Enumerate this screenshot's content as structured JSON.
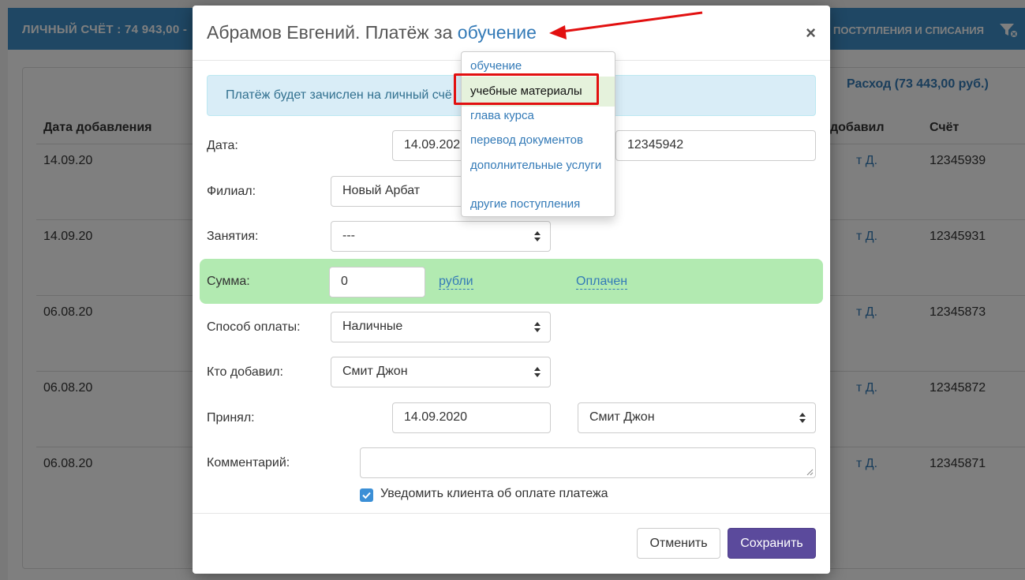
{
  "background": {
    "account_label": "ЛИЧНЫЙ СЧЁТ :  74 943,00 -",
    "flow_label": "ПОСТУПЛЕНИЯ И СПИСАНИЯ",
    "expense": "Расход (73 443,00 руб.)",
    "headers": {
      "date": "Дата добавления",
      "who": "добавил",
      "account": "Счёт"
    },
    "rows": [
      {
        "date": "14.09.20",
        "who": "т Д.",
        "account": "12345939"
      },
      {
        "date": "14.09.20",
        "who": "т Д.",
        "account": "12345931"
      },
      {
        "date": "06.08.20",
        "who": "т Д.",
        "account": "12345873"
      },
      {
        "date": "06.08.20",
        "who": "т Д.",
        "account": "12345872"
      },
      {
        "date": "06.08.20",
        "who": "т Д.",
        "account": "12345871"
      }
    ]
  },
  "modal": {
    "title_prefix": "Абрамов Евгений. Платёж за",
    "title_link": "обучение",
    "close": "×",
    "alert": "Платёж будет зачислен на личный счё",
    "fields": {
      "date_label": "Дата:",
      "date_value": "14.09.202",
      "account_value": "12345942",
      "branch_label": "Филиал:",
      "branch_value": "Новый Арбат",
      "lessons_label": "Занятия:",
      "lessons_value": "---",
      "sum_label": "Сумма:",
      "sum_value": "0",
      "currency_link": "рубли",
      "status_link": "Оплачен",
      "method_label": "Способ оплаты:",
      "method_value": "Наличные",
      "added_by_label": "Кто добавил:",
      "added_by_value": "Смит Джон",
      "accepted_label": "Принял:",
      "accepted_date": "14.09.2020",
      "accepted_by": "Смит Джон",
      "comment_label": "Комментарий:",
      "notify_label": "Уведомить клиента об оплате платежа",
      "notify_checked": true
    },
    "buttons": {
      "cancel": "Отменить",
      "save": "Сохранить"
    }
  },
  "dropdown": {
    "items": [
      "обучение",
      "учебные материалы",
      "глава курса",
      "перевод документов",
      "дополнительные услуги",
      "другие поступления"
    ],
    "highlighted_index": 1
  },
  "colors": {
    "header_bg": "#3e8fc9",
    "link": "#337ab7",
    "sum_band": "#b2eab1",
    "save_button": "#5b4a9c",
    "highlight_box": "#e21010"
  }
}
